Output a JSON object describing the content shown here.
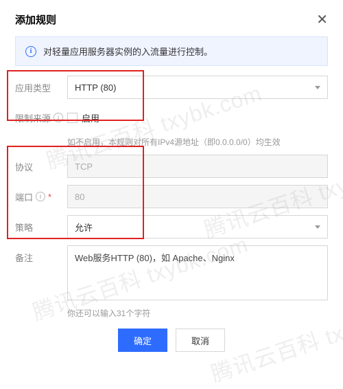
{
  "header": {
    "title": "添加规则"
  },
  "info": {
    "text": "对轻量应用服务器实例的入流量进行控制。"
  },
  "fields": {
    "app_type": {
      "label": "应用类型",
      "value": "HTTP (80)"
    },
    "source": {
      "label": "限制来源",
      "checkbox_label": "启用",
      "hint": "如不启用，本规则对所有IPv4源地址（即0.0.0.0/0）均生效"
    },
    "protocol": {
      "label": "协议",
      "value": "TCP"
    },
    "port": {
      "label": "端口",
      "value": "80"
    },
    "policy": {
      "label": "策略",
      "value": "允许"
    },
    "remark": {
      "label": "备注",
      "value": "Web服务HTTP (80)，如 Apache、Nginx",
      "hint": "你还可以输入31个字符"
    }
  },
  "footer": {
    "ok": "确定",
    "cancel": "取消"
  },
  "watermark": "腾讯云百科 txybk.com"
}
